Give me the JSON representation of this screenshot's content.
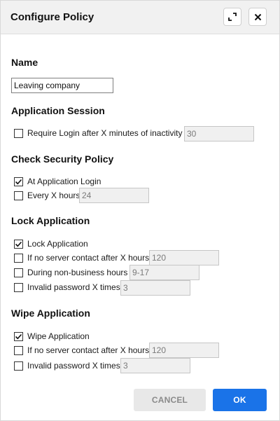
{
  "dialog": {
    "title": "Configure Policy"
  },
  "name_section": {
    "title": "Name",
    "value": "Leaving company"
  },
  "application_session": {
    "title": "Application Session",
    "require_login": {
      "label": "Require Login after X minutes of inactivity",
      "checked": false,
      "value": "30"
    }
  },
  "check_security_policy": {
    "title": "Check Security Policy",
    "at_login": {
      "label": "At Application Login",
      "checked": true
    },
    "every_x_hours": {
      "label": "Every X hours",
      "checked": false,
      "value": "24"
    }
  },
  "lock_application": {
    "title": "Lock Application",
    "lock": {
      "label": "Lock Application",
      "checked": true
    },
    "no_server_contact": {
      "label": "If no server contact after X hours",
      "checked": false,
      "value": "120"
    },
    "non_business_hours": {
      "label": "During non-business hours",
      "checked": false,
      "value": "9-17"
    },
    "invalid_password": {
      "label": "Invalid password X times",
      "checked": false,
      "value": "3"
    }
  },
  "wipe_application": {
    "title": "Wipe Application",
    "wipe": {
      "label": "Wipe Application",
      "checked": true
    },
    "no_server_contact": {
      "label": "If no server contact after X hours",
      "checked": false,
      "value": "120"
    },
    "invalid_password": {
      "label": "Invalid password X times",
      "checked": false,
      "value": "3"
    }
  },
  "buttons": {
    "cancel": "CANCEL",
    "ok": "OK"
  },
  "icons": {
    "maximize": "expand-icon",
    "close": "close-icon",
    "check": "checkmark-icon"
  },
  "colors": {
    "primary": "#1a73e8",
    "header_bg": "#f1f1f1",
    "disabled_input_bg": "#f0f0f0"
  }
}
